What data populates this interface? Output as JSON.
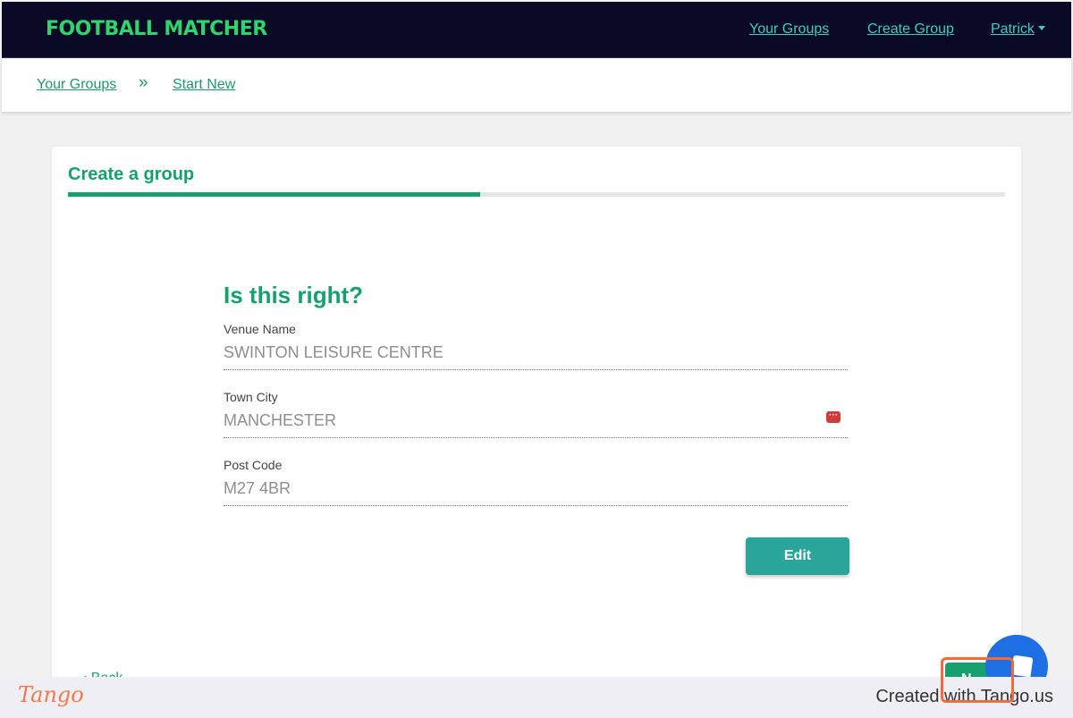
{
  "navbar": {
    "logo": "FOOTBALL MATCHER",
    "links": [
      "Your Groups",
      "Create Group"
    ],
    "user": "Patrick"
  },
  "breadcrumb": {
    "items": [
      "Your Groups",
      "Start New"
    ],
    "separator": "»"
  },
  "card": {
    "title": "Create a group",
    "progress": 0.44,
    "heading": "Is this right?",
    "fields": [
      {
        "label": "Venue Name",
        "value": "SWINTON LEISURE CENTRE"
      },
      {
        "label": "Town City",
        "value": "MANCHESTER"
      },
      {
        "label": "Post Code",
        "value": "M27 4BR"
      }
    ],
    "edit_label": "Edit",
    "back_label": "‹ Back",
    "next_label": "N"
  },
  "footer": {
    "brand": "Tango",
    "credit": "Created with Tango.us"
  },
  "colors": {
    "navbar_bg": "#0b0a26",
    "accent_green": "#16a06d",
    "link_teal": "#3ad0b8",
    "button_teal": "#2aa59a",
    "highlight": "#f06b3c"
  }
}
